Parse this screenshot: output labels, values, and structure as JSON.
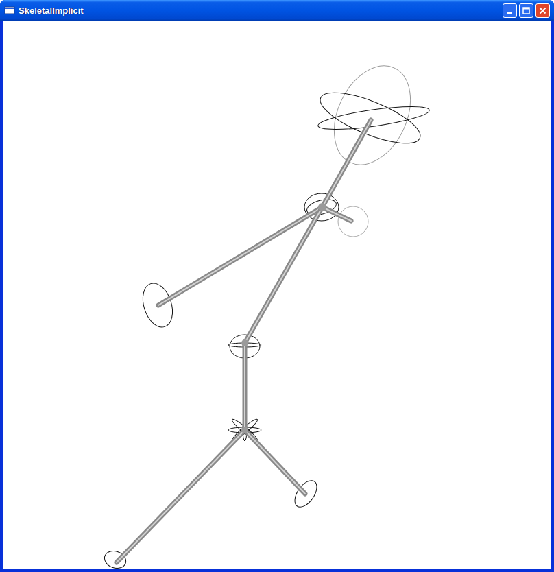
{
  "window": {
    "title": "SkeletalImplicit"
  }
}
